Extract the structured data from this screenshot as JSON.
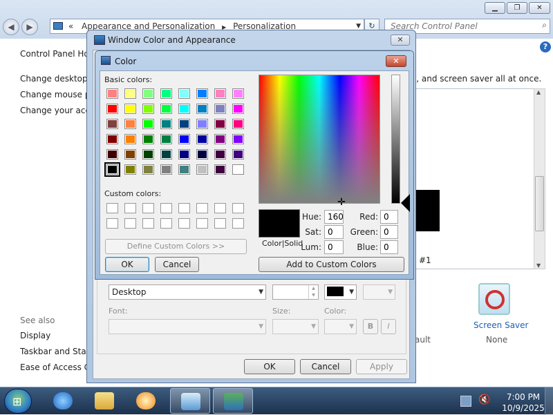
{
  "control_panel": {
    "breadcrumb": [
      "«",
      "Appearance and Personalization",
      "Personalization"
    ],
    "search_placeholder": "Search Control Panel",
    "sidebar": {
      "home": "Control Panel Hom",
      "links": [
        "Change desktop ic",
        "Change mouse po",
        "Change your acco"
      ],
      "see_also_heading": "See also",
      "see_also": [
        "Display",
        "Taskbar and Start M",
        "Ease of Access Cen"
      ]
    },
    "description": "s, and screen saver all at once.",
    "theme_label": "#1",
    "screen_saver": {
      "label": "Screen Saver",
      "value": "None"
    },
    "default_fragment": "ault"
  },
  "window_color": {
    "title": "Window Color and Appearance",
    "close": "✕",
    "item_value": "Desktop",
    "font_label": "Font:",
    "size_label": "Size:",
    "color_label": "Color:",
    "bold": "B",
    "italic": "I",
    "ok": "OK",
    "cancel": "Cancel",
    "apply": "Apply"
  },
  "color_dialog": {
    "title": "Color",
    "close": "✕",
    "basic_colors_label": "Basic colors:",
    "basic_colors": [
      "#ff8080",
      "#ffff80",
      "#80ff80",
      "#00ff80",
      "#80ffff",
      "#0080ff",
      "#ff80c0",
      "#ff80ff",
      "#ff0000",
      "#ffff00",
      "#80ff00",
      "#00ff40",
      "#00ffff",
      "#0080c0",
      "#8080c0",
      "#ff00ff",
      "#804040",
      "#ff8040",
      "#00ff00",
      "#008080",
      "#004080",
      "#8080ff",
      "#800040",
      "#ff0080",
      "#800000",
      "#ff8000",
      "#008000",
      "#008040",
      "#0000ff",
      "#0000a0",
      "#800080",
      "#8000ff",
      "#400000",
      "#804000",
      "#004000",
      "#004040",
      "#000080",
      "#000040",
      "#400040",
      "#400080",
      "#000000",
      "#808000",
      "#808040",
      "#808080",
      "#408080",
      "#c0c0c0",
      "#400040",
      "#ffffff"
    ],
    "selected_index": 40,
    "custom_colors_label": "Custom colors:",
    "define_custom": "Define Custom Colors >>",
    "ok": "OK",
    "cancel": "Cancel",
    "add_custom": "Add to Custom Colors",
    "color_solid_label": "Color|Solid",
    "fields": {
      "hue": {
        "label": "Hue:",
        "value": "160"
      },
      "sat": {
        "label": "Sat:",
        "value": "0"
      },
      "lum": {
        "label": "Lum:",
        "value": "0"
      },
      "red": {
        "label": "Red:",
        "value": "0"
      },
      "green": {
        "label": "Green:",
        "value": "0"
      },
      "blue": {
        "label": "Blue:",
        "value": "0"
      }
    },
    "current_color": "#000000"
  },
  "taskbar": {
    "time": "7:00 PM",
    "date": "10/9/2025"
  },
  "icons": {
    "back": "back-arrow-icon",
    "forward": "forward-arrow-icon",
    "search": "search-icon",
    "help": "help-icon",
    "start": "windows-start-icon",
    "ie": "internet-explorer-icon",
    "explorer": "folder-icon",
    "media": "media-player-icon"
  }
}
